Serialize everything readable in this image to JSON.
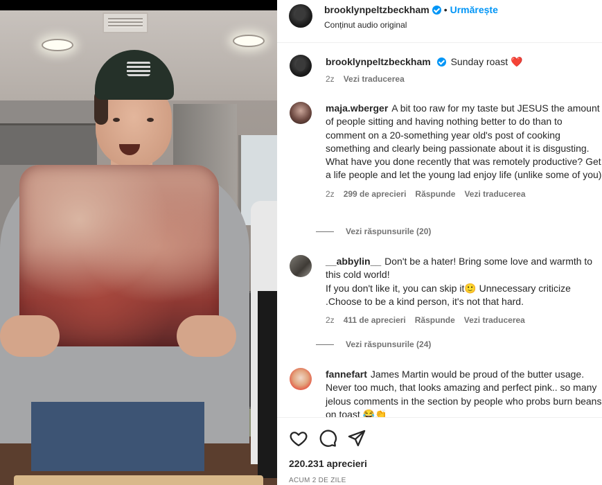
{
  "post": {
    "author": "brooklynpeltzbeckham",
    "follow_label": "Urmărește",
    "audio_label": "Conținut audio original",
    "caption": "Sunday roast",
    "caption_emoji": "❤️",
    "caption_time": "2z",
    "caption_translate": "Vezi traducerea"
  },
  "comments": [
    {
      "username": "maja.wberger",
      "text": "A bit too raw for my taste but JESUS the amount of people sitting and having nothing better to do than to comment on a 20-something year old's post of cooking something and clearly being passionate about it is disgusting. What have you done recently that was remotely productive? Get a life people and let the young lad enjoy life (unlike some of you)",
      "time": "2z",
      "likes": "299 de aprecieri",
      "reply": "Răspunde",
      "translate": "Vezi traducerea",
      "view_replies": "Vezi răspunsurile (20)"
    },
    {
      "username": "__abbylin__",
      "text": "Don't be a hater! Bring some love and warmth to this cold world!\nIf you don't like it, you can skip it🙂 Unnecessary criticize .Choose to be a kind person, it's not that hard.",
      "time": "2z",
      "likes": "411 de aprecieri",
      "reply": "Răspunde",
      "translate": "Vezi traducerea",
      "view_replies": "Vezi răspunsurile (24)"
    },
    {
      "username": "fannefart",
      "text": "James Martin would be proud of the butter usage. Never too much, that looks amazing and perfect pink.. so many jelous comments in the section by people who probs burn beans on toast 😂👏"
    }
  ],
  "footer": {
    "likes": "220.231 aprecieri",
    "date": "ACUM 2 DE ZILE"
  },
  "icons": {
    "like": "heart-outline-icon",
    "comment": "comment-bubble-icon",
    "share": "paper-plane-icon",
    "verified": "verified-badge-icon"
  },
  "colors": {
    "link_blue": "#0095f6",
    "muted": "#737373",
    "text": "#262626"
  }
}
